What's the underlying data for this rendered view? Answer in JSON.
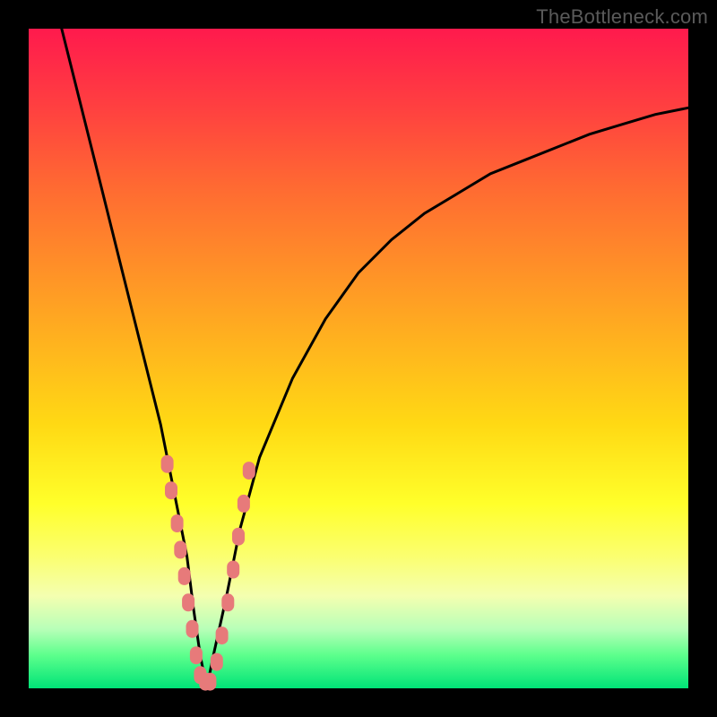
{
  "watermark": "TheBottleneck.com",
  "colors": {
    "frame": "#000000",
    "curve": "#000000",
    "marker": "#e77a7a",
    "gradient_top": "#ff1a4d",
    "gradient_bottom": "#00e377"
  },
  "chart_data": {
    "type": "line",
    "title": "",
    "xlabel": "",
    "ylabel": "",
    "xlim": [
      0,
      100
    ],
    "ylim": [
      0,
      100
    ],
    "series": [
      {
        "name": "bottleneck-curve",
        "x": [
          5,
          8,
          11,
          14,
          17,
          20,
          22,
          24,
          25,
          26,
          27,
          28,
          30,
          32,
          35,
          40,
          45,
          50,
          55,
          60,
          65,
          70,
          75,
          80,
          85,
          90,
          95,
          100
        ],
        "y": [
          100,
          88,
          76,
          64,
          52,
          40,
          30,
          20,
          12,
          5,
          0,
          5,
          14,
          24,
          35,
          47,
          56,
          63,
          68,
          72,
          75,
          78,
          80,
          82,
          84,
          85.5,
          87,
          88
        ]
      }
    ],
    "markers": {
      "name": "highlight-points",
      "x": [
        21.0,
        21.6,
        22.5,
        23.0,
        23.6,
        24.2,
        24.8,
        25.4,
        26.0,
        26.8,
        27.5,
        28.5,
        29.3,
        30.2,
        31.0,
        31.8,
        32.6,
        33.4
      ],
      "y": [
        34,
        30,
        25,
        21,
        17,
        13,
        9,
        5,
        2,
        1,
        1,
        4,
        8,
        13,
        18,
        23,
        28,
        33
      ]
    }
  }
}
